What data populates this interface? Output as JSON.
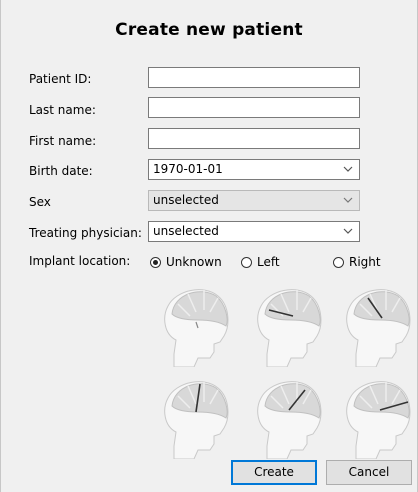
{
  "dialog": {
    "title": "Create new patient"
  },
  "form": {
    "patient_id": {
      "label": "Patient ID:",
      "value": ""
    },
    "last_name": {
      "label": "Last name:",
      "value": ""
    },
    "first_name": {
      "label": "First name:",
      "value": ""
    },
    "birth_date": {
      "label": "Birth date:",
      "value": "1970-01-01"
    },
    "sex": {
      "label": "Sex",
      "value": "unselected",
      "enabled": false
    },
    "physician": {
      "label": "Treating physician:",
      "value": "unselected"
    },
    "implant": {
      "label": "Implant location:",
      "options": [
        "Unknown",
        "Left",
        "Right"
      ],
      "selected": "Unknown"
    }
  },
  "buttons": {
    "create": "Create",
    "cancel": "Cancel"
  },
  "colors": {
    "primary_border": "#0078d7",
    "head_fill": "#f2f2f2",
    "head_shade": "#d9d9d9"
  },
  "icons": [
    "chevron-down-icon",
    "head-diagram-icon"
  ]
}
